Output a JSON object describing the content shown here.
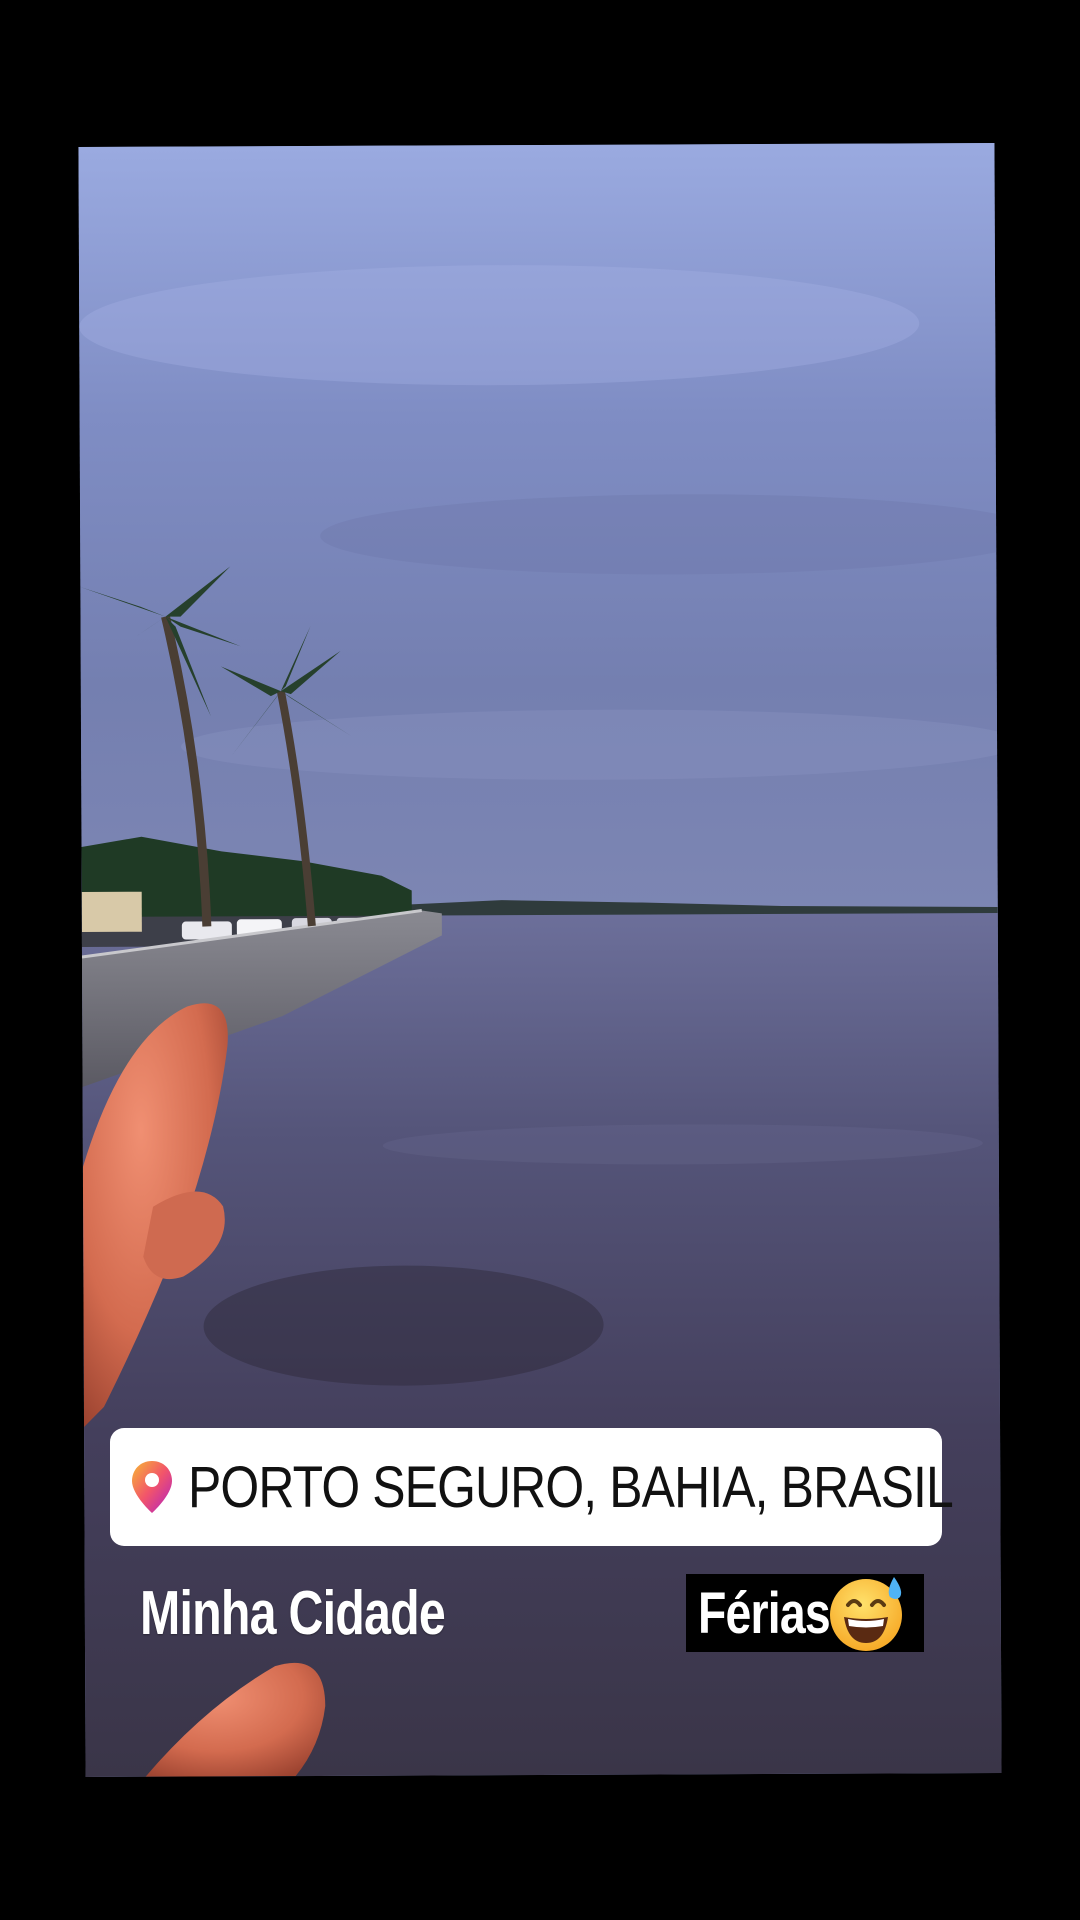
{
  "location_sticker": {
    "text": "PORTO SEGURO, BAHIA, BRASIL",
    "icon": "location-pin-icon"
  },
  "captions": {
    "left": "Minha Cidade",
    "right": "Férias",
    "right_emoji": "grinning-sweat-emoji-icon"
  },
  "colors": {
    "sky": "#8b9bd4",
    "water": "#4f4a66",
    "sticker_bg": "#ffffff",
    "pin_gradient_start": "#f7b733",
    "pin_gradient_end": "#e1306c"
  }
}
